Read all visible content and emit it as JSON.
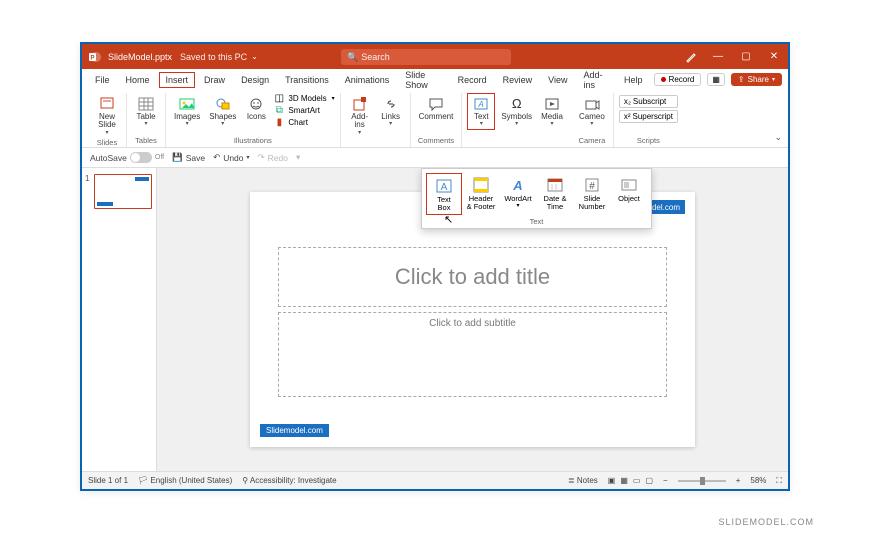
{
  "title": {
    "filename": "SlideModel.pptx",
    "savedStatus": "Saved to this PC"
  },
  "search": {
    "placeholder": "Search"
  },
  "window": {
    "min": "—",
    "max": "▢",
    "close": "✕"
  },
  "tabs": {
    "items": [
      "File",
      "Home",
      "Insert",
      "Draw",
      "Design",
      "Transitions",
      "Animations",
      "Slide Show",
      "Record",
      "Review",
      "View",
      "Add-ins",
      "Help"
    ],
    "record": "Record",
    "share": "Share"
  },
  "ribbon": {
    "newSlide": "New\nSlide",
    "slidesGroup": "Slides",
    "table": "Table",
    "tablesGroup": "Tables",
    "images": "Images",
    "shapes": "Shapes",
    "icons": "Icons",
    "models3d": "3D Models",
    "smartart": "SmartArt",
    "chart": "Chart",
    "illustrationsGroup": "Illustrations",
    "addins": "Add-\nins",
    "links": "Links",
    "comment": "Comment",
    "commentsGroup": "Comments",
    "text": "Text",
    "symbols": "Symbols",
    "media": "Media",
    "cameo": "Cameo",
    "cameraGroup": "Camera",
    "subscript": "Subscript",
    "superscript": "Superscript",
    "scriptsGroup": "Scripts"
  },
  "textDropdown": {
    "textBox": "Text\nBox",
    "headerFooter": "Header\n& Footer",
    "wordArt": "WordArt",
    "dateTime": "Date &\nTime",
    "slideNumber": "Slide\nNumber",
    "object": "Object",
    "groupLabel": "Text"
  },
  "qat": {
    "autoSave": "AutoSave",
    "off": "Off",
    "save": "Save",
    "undo": "Undo",
    "redo": "Redo"
  },
  "thumb": {
    "num": "1"
  },
  "slide": {
    "brand": "Model",
    "brandSuffix": ".com",
    "titlePH": "Click to add title",
    "subPH": "Click to add subtitle",
    "footerBrand": "Slidemodel.com"
  },
  "status": {
    "slideN": "Slide 1 of 1",
    "lang": "English (United States)",
    "access": "Accessibility: Investigate",
    "notes": "Notes",
    "zoomPct": "58%"
  },
  "attribution": "SLIDEMODEL.COM"
}
